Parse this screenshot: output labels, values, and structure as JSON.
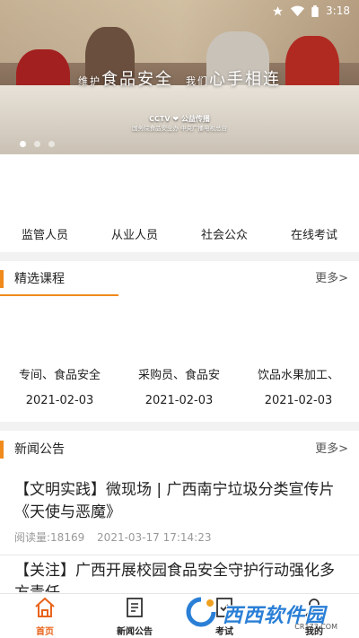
{
  "status_bar": {
    "time": "3:18"
  },
  "banner": {
    "headline_left_small": "维护",
    "headline_left": "食品安全",
    "headline_right_small": "我们",
    "headline_right": "心手相连",
    "credits_logos": "CCTV  ❤ 公益传播",
    "credits_line": "国务院食品安全办   中央广播电视总台",
    "active_slide": 0,
    "slide_count": 3
  },
  "quick_nav": [
    {
      "label": "监管人员"
    },
    {
      "label": "从业人员"
    },
    {
      "label": "社会公众"
    },
    {
      "label": "在线考试"
    }
  ],
  "courses_section": {
    "title": "精选课程",
    "more": "更多>"
  },
  "courses": [
    {
      "title": "专间、食品安全",
      "date": "2021-02-03"
    },
    {
      "title": "采购员、食品安",
      "date": "2021-02-03"
    },
    {
      "title": "饮品水果加工、",
      "date": "2021-02-03"
    }
  ],
  "news_section": {
    "title": "新闻公告",
    "more": "更多>"
  },
  "news": [
    {
      "title": "【文明实践】微现场 | 广西南宁垃圾分类宣传片《天使与恶魔》",
      "reads": "阅读量:18169",
      "time": "2021-03-17 17:14:23"
    },
    {
      "title": "【关注】广西开展校园食品安全守护行动强化多方责任",
      "reads": "",
      "time": ""
    }
  ],
  "tabbar": [
    {
      "label": "首页",
      "icon": "home-icon",
      "active": true
    },
    {
      "label": "新闻公告",
      "icon": "news-icon",
      "active": false
    },
    {
      "label": "考试",
      "icon": "exam-icon",
      "active": false
    },
    {
      "label": "我的",
      "icon": "profile-icon",
      "active": false
    }
  ],
  "watermark": {
    "text": "西西软件园",
    "url": "CR173.COM"
  },
  "colors": {
    "accent": "#f08a1c",
    "tab_active": "#e8641b",
    "divider": "#f2f2f2"
  }
}
